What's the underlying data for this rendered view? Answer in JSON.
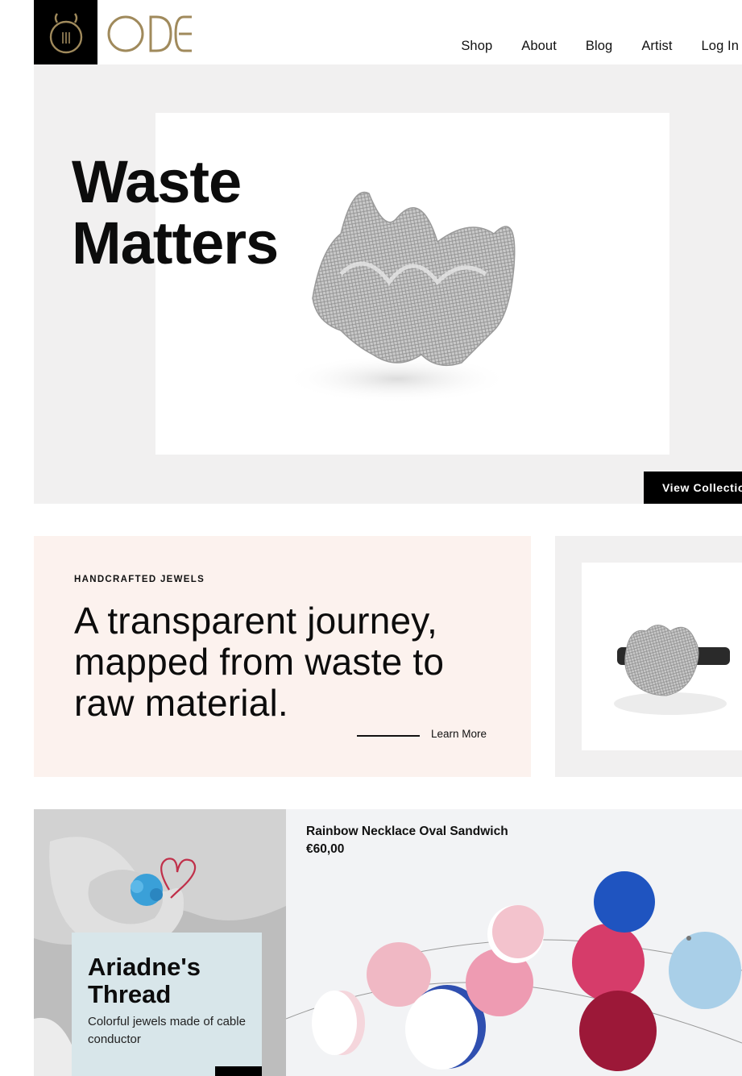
{
  "header": {
    "logo_text": "ODE",
    "nav": [
      "Shop",
      "About",
      "Blog",
      "Artist",
      "Log In"
    ]
  },
  "hero": {
    "title_line1": "Waste",
    "title_line2": "Matters",
    "button_label": "View Collection"
  },
  "journey": {
    "eyebrow": "HANDCRAFTED JEWELS",
    "heading": "A transparent journey, mapped from waste to raw material.",
    "link_label": "Learn More"
  },
  "ariadne": {
    "title_line1": "Ariadne's",
    "title_line2": "Thread",
    "subtitle": "Colorful jewels made of cable conductor"
  },
  "product": {
    "name": "Rainbow Necklace Oval Sandwich",
    "price": "€60,00"
  },
  "colors": {
    "brand_gold": "#a08a5c",
    "hero_bg": "#f1f0f0",
    "journey_bg": "#fcf2ee",
    "ariadne_panel": "#d8e6ea",
    "button_bg": "#000000"
  }
}
